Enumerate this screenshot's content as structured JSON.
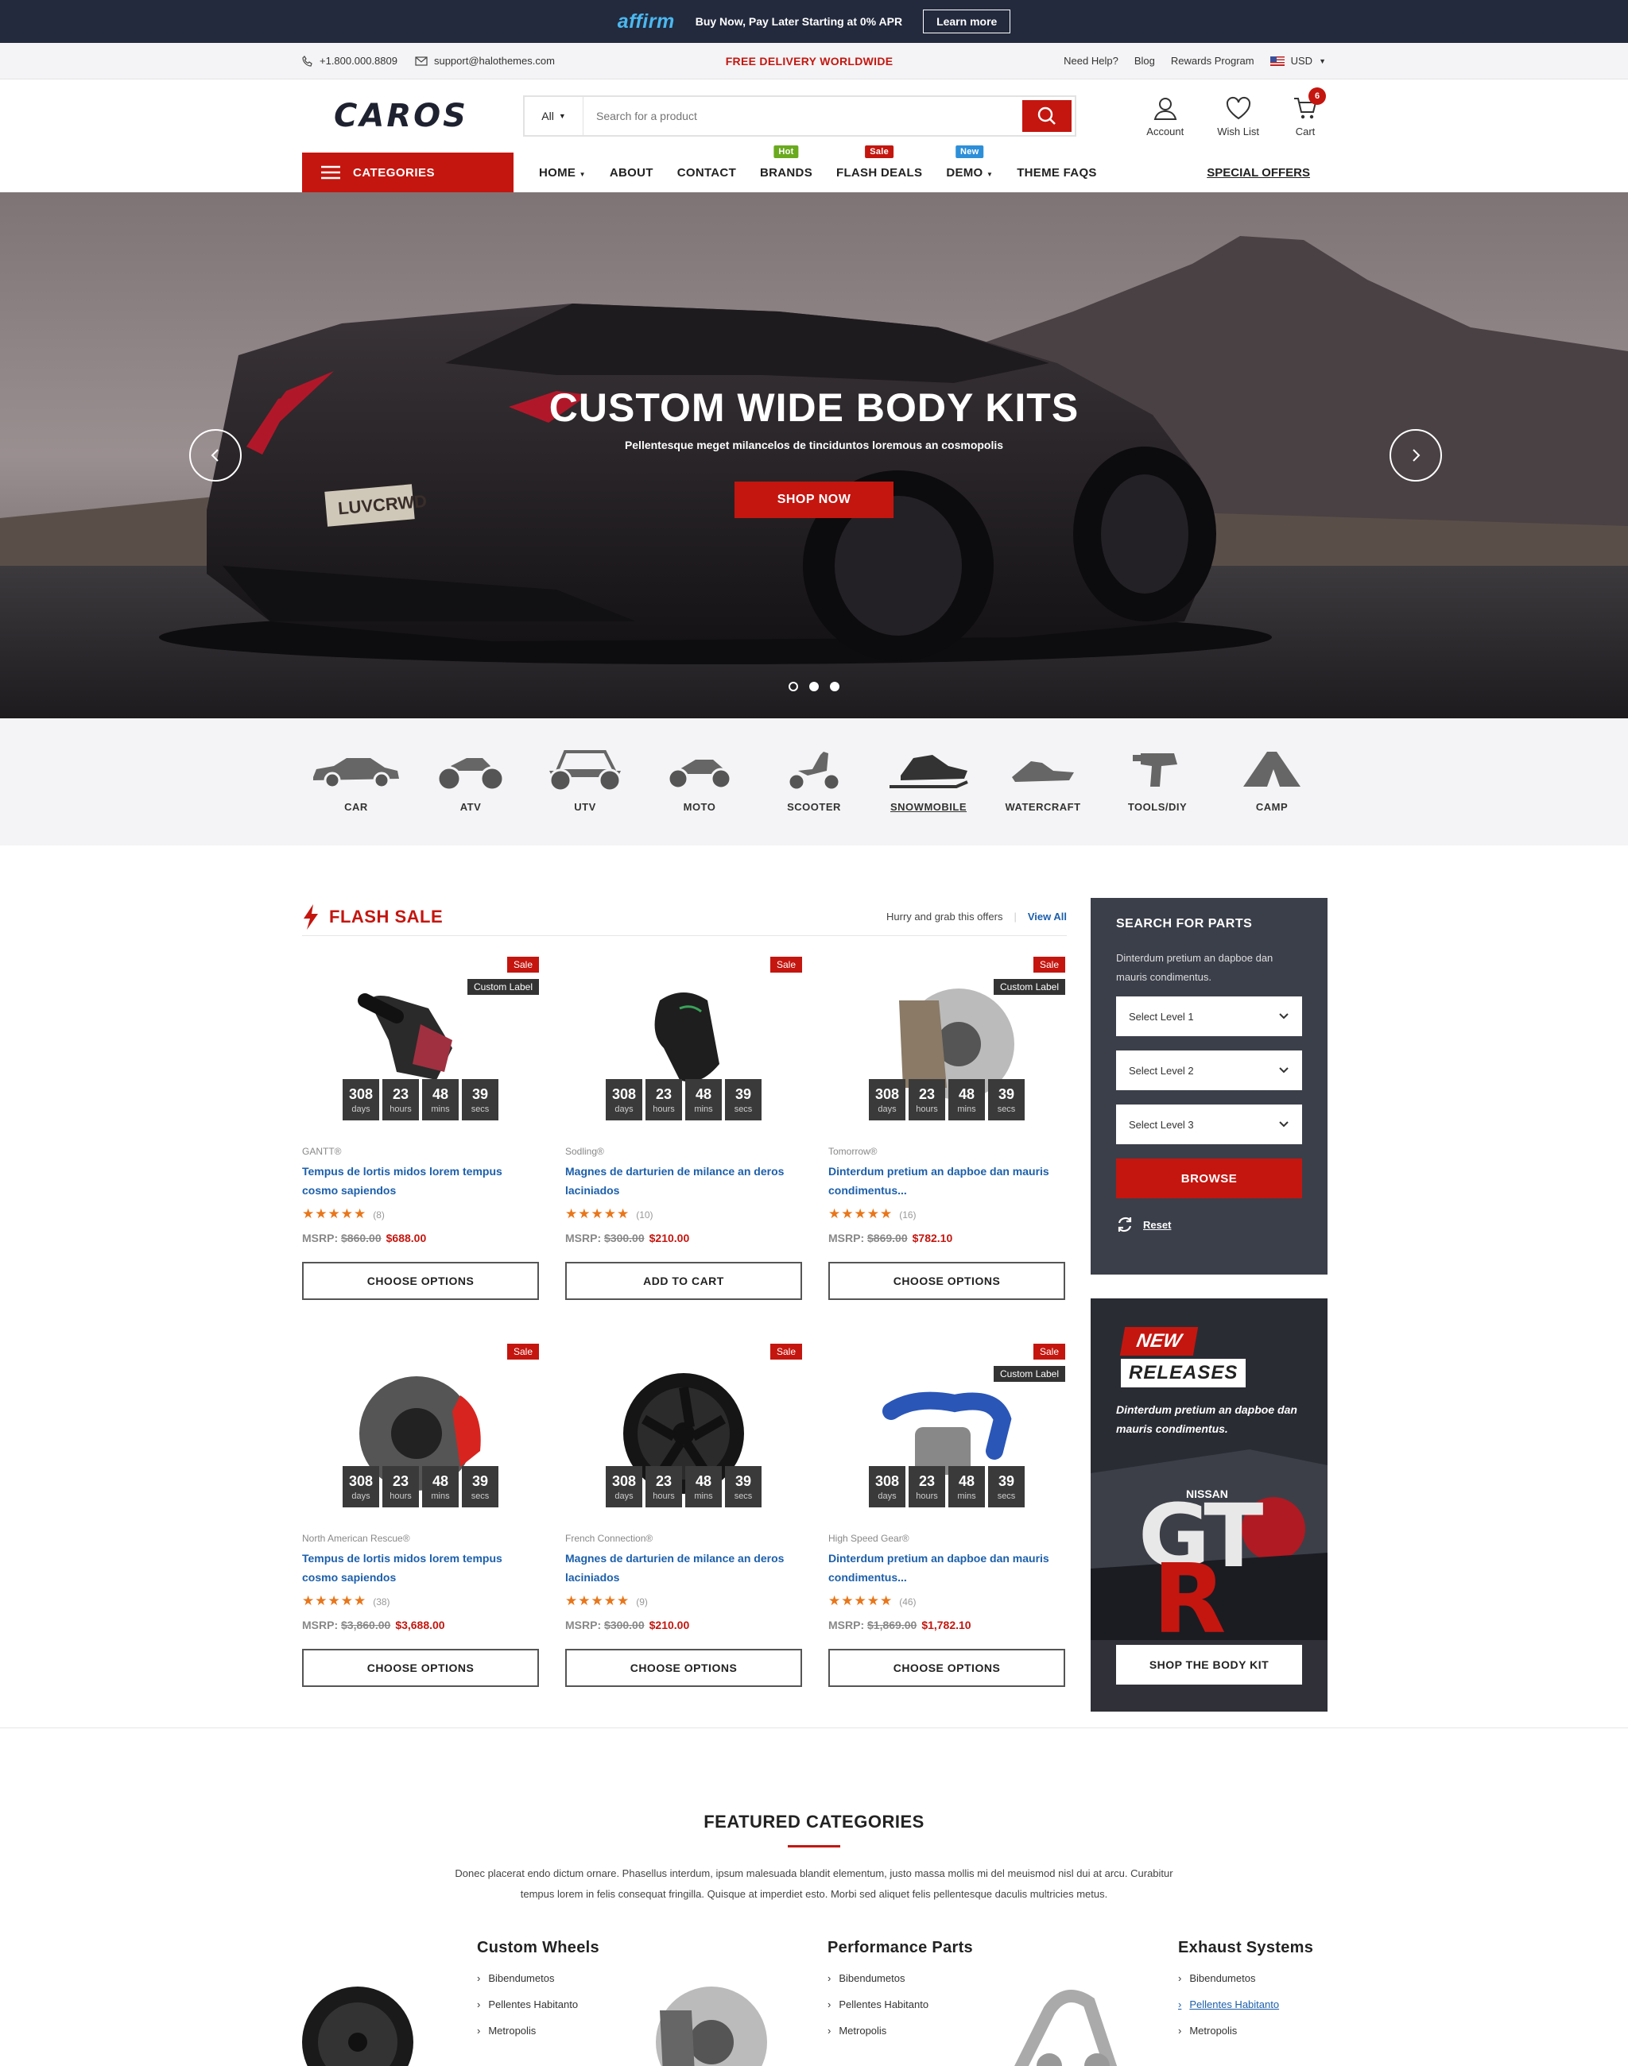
{
  "promo": {
    "brand": "affirm",
    "text": "Buy Now, Pay Later Starting at 0% APR",
    "button": "Learn more"
  },
  "topbar": {
    "phone": "+1.800.000.8809",
    "email": "support@halothemes.com",
    "center": "FREE DELIVERY WORLDWIDE",
    "links": [
      "Need Help?",
      "Blog",
      "Rewards Program"
    ],
    "currency": "USD"
  },
  "header": {
    "logo": "CAROS",
    "search_category": "All",
    "search_placeholder": "Search for a product",
    "account": "Account",
    "wishlist": "Wish List",
    "cart": "Cart",
    "cart_count": "6"
  },
  "nav": {
    "categories": "CATEGORIES",
    "links": [
      {
        "label": "HOME",
        "badge": ""
      },
      {
        "label": "ABOUT",
        "badge": ""
      },
      {
        "label": "CONTACT",
        "badge": ""
      },
      {
        "label": "BRANDS",
        "badge": "Hot"
      },
      {
        "label": "FLASH DEALS",
        "badge": "Sale"
      },
      {
        "label": "DEMO",
        "badge": "New"
      },
      {
        "label": "THEME FAQS",
        "badge": ""
      }
    ],
    "special": "SPECIAL OFFERS"
  },
  "hero": {
    "title": "CUSTOM WIDE BODY KITS",
    "subtitle": "Pellentesque meget milancelos de tinciduntos loremous an cosmopolis",
    "button": "SHOP NOW",
    "plate": "LUVCRWD"
  },
  "vehicles": [
    "CAR",
    "ATV",
    "UTV",
    "MOTO",
    "SCOOTER",
    "SNOWMOBILE",
    "WATERCRAFT",
    "TOOLS/DIY",
    "CAMP"
  ],
  "flash": {
    "title": "FLASH SALE",
    "tagline": "Hurry and grab this offers",
    "view_all": "View All",
    "sale": "Sale",
    "custom": "Custom Label",
    "countdown": {
      "days": "308",
      "hours": "23",
      "mins": "48",
      "secs": "39",
      "l_days": "days",
      "l_hours": "hours",
      "l_mins": "mins",
      "l_secs": "secs"
    },
    "products": [
      {
        "brand": "GANTT®",
        "title": "Tempus de lortis midos lorem tempus cosmo sapiendos",
        "reviews": "(8)",
        "msrp_label": "MSRP:",
        "msrp": "$860.00",
        "price": "$688.00",
        "button": "CHOOSE OPTIONS"
      },
      {
        "brand": "Sodling®",
        "title": "Magnes de darturien de milance an deros laciniados",
        "reviews": "(10)",
        "msrp_label": "MSRP:",
        "msrp": "$300.00",
        "price": "$210.00",
        "button": "ADD TO CART"
      },
      {
        "brand": "Tomorrow®",
        "title": "Dinterdum pretium an dapboe dan mauris condimentus...",
        "reviews": "(16)",
        "msrp_label": "MSRP:",
        "msrp": "$869.00",
        "price": "$782.10",
        "button": "CHOOSE OPTIONS"
      },
      {
        "brand": "North American Rescue®",
        "title": "Tempus de lortis midos lorem tempus cosmo sapiendos",
        "reviews": "(38)",
        "msrp_label": "MSRP:",
        "msrp": "$3,860.00",
        "price": "$3,688.00",
        "button": "CHOOSE OPTIONS"
      },
      {
        "brand": "French Connection®",
        "title": "Magnes de darturien de milance an deros laciniados",
        "reviews": "(9)",
        "msrp_label": "MSRP:",
        "msrp": "$300.00",
        "price": "$210.00",
        "button": "CHOOSE OPTIONS"
      },
      {
        "brand": "High Speed Gear®",
        "title": "Dinterdum pretium an dapboe dan mauris condimentus...",
        "reviews": "(46)",
        "msrp_label": "MSRP:",
        "msrp": "$1,869.00",
        "price": "$1,782.10",
        "button": "CHOOSE OPTIONS"
      }
    ]
  },
  "parts": {
    "title": "SEARCH FOR PARTS",
    "desc": "Dinterdum pretium an dapboe dan mauris condimentus.",
    "levels": [
      "Select Level 1",
      "Select Level 2",
      "Select Level 3"
    ],
    "browse": "BROWSE",
    "reset": "Reset"
  },
  "banner": {
    "new": "NEW",
    "releases": "RELEASES",
    "desc": "Dinterdum pretium an dapboe dan mauris condimentus.",
    "make": "NISSAN",
    "model_a": "GT",
    "model_b": "R",
    "button": "SHOP THE BODY KIT"
  },
  "featured": {
    "title": "FEATURED CATEGORIES",
    "desc": "Donec placerat endo dictum ornare. Phasellus interdum, ipsum malesuada blandit elementum, justo massa mollis mi del meuismod nisl dui at arcu. Curabitur tempus lorem in felis consequat fringilla. Quisque at imperdiet esto. Morbi sed aliquet felis pellentesque daculis multricies metus.",
    "cats": [
      {
        "name": "Custom Wheels",
        "items": [
          "Bibendumetos",
          "Pellentes Habitanto",
          "Metropolis"
        ]
      },
      {
        "name": "Performance Parts",
        "items": [
          "Bibendumetos",
          "Pellentes Habitanto",
          "Metropolis"
        ]
      },
      {
        "name": "Exhaust Systems",
        "items": [
          "Bibendumetos",
          "Pellentes Habitanto",
          "Metropolis"
        ]
      }
    ]
  },
  "colors": {
    "accent": "#c4160f",
    "link": "#1c5fab",
    "dark": "#232a3d"
  }
}
